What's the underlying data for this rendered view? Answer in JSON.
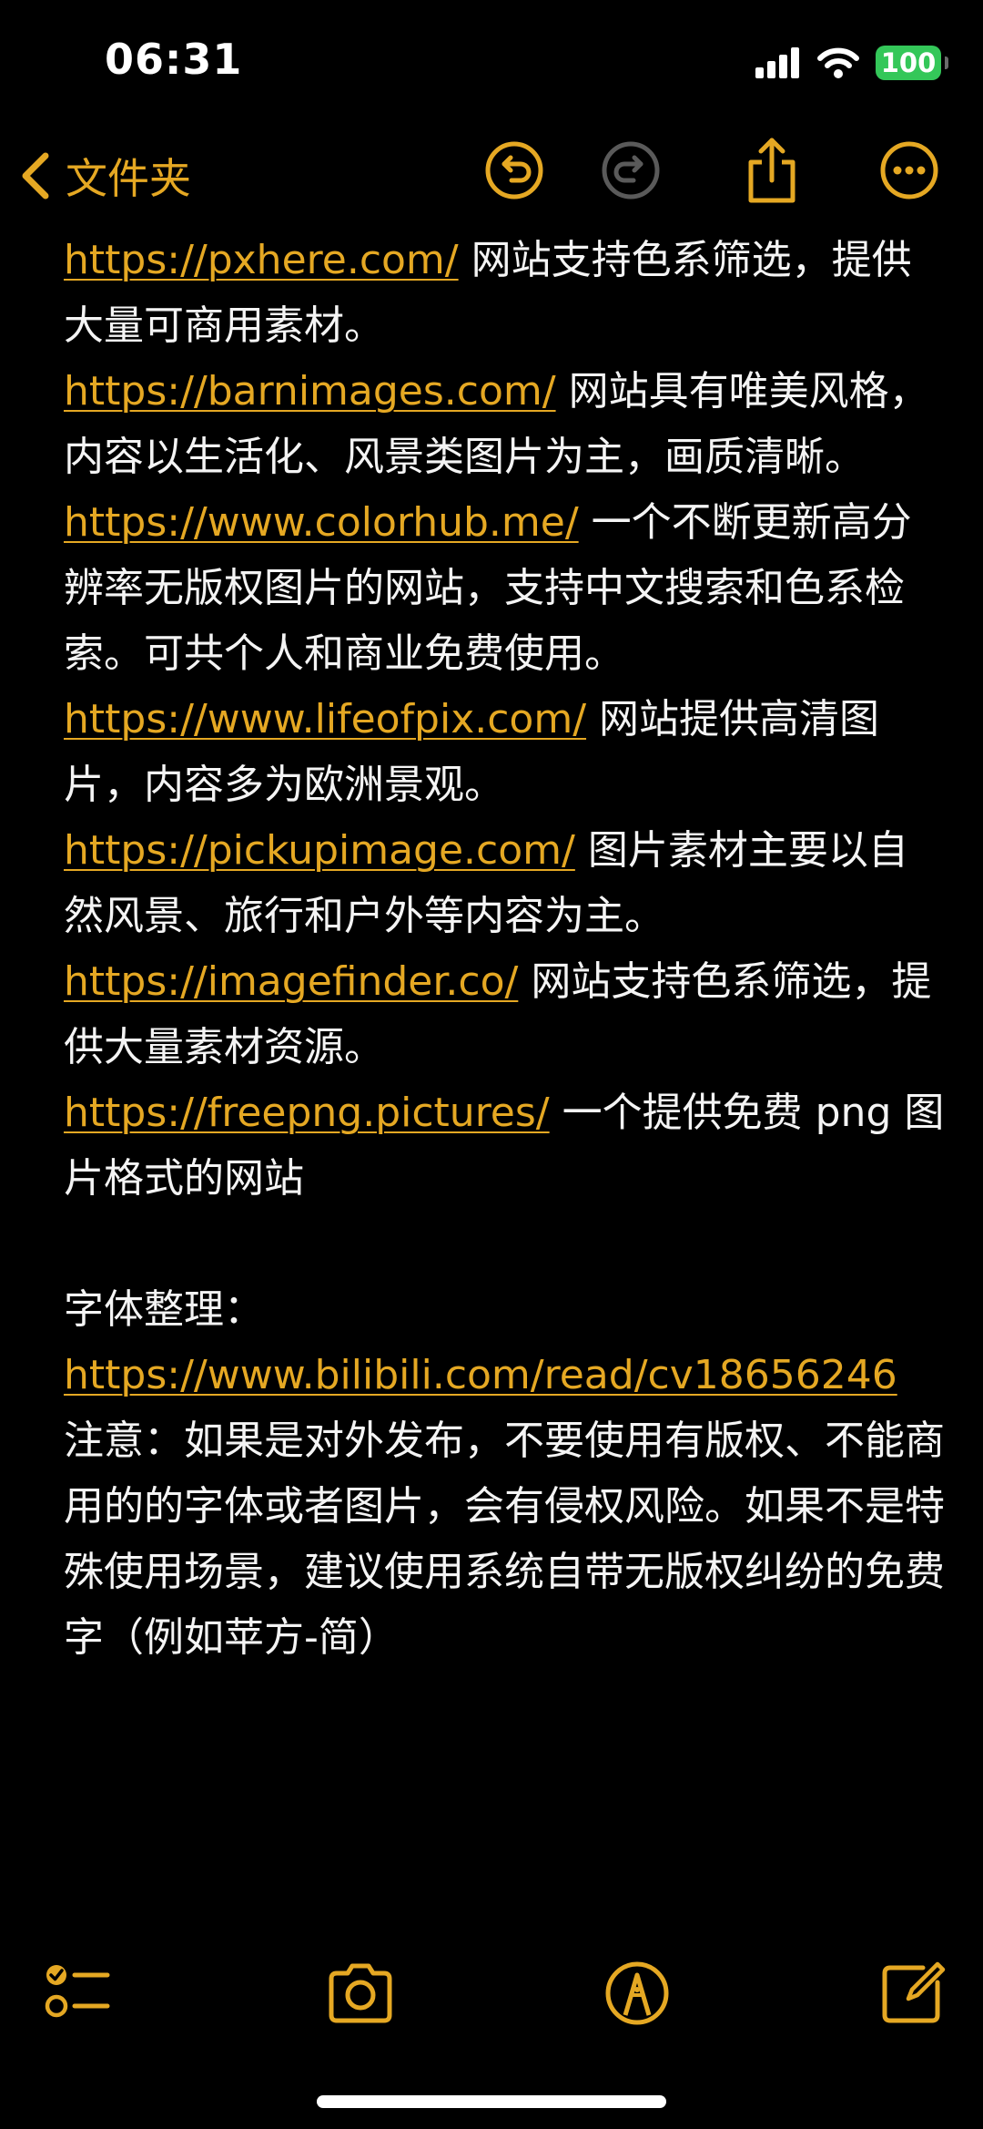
{
  "status_bar": {
    "time": "06:31",
    "battery": "100",
    "battery_color": "#34c759"
  },
  "nav": {
    "back_label": "文件夹",
    "icons": [
      "chevron-left-icon",
      "undo-icon",
      "redo-icon",
      "share-icon",
      "more-icon"
    ],
    "accent_color": "#e5a823"
  },
  "entries": [
    {
      "url": "https://pxhere.com/",
      "desc": "网站支持色系筛选，提供大量可商用素材。"
    },
    {
      "url": "https://barnimages.com/",
      "desc": "网站具有唯美风格，内容以生活化、风景类图片为主，画质清晰。"
    },
    {
      "url": "https://www.colorhub.me/",
      "desc": "一个不断更新高分辨率无版权图片的网站，支持中文搜索和色系检索。可共个人和商业免费使用。"
    },
    {
      "url": "https://www.lifeofpix.com/",
      "desc": "网站提供高清图片，内容多为欧洲景观。"
    },
    {
      "url": "https://pickupimage.com/",
      "desc": "图片素材主要以自然风景、旅行和户外等内容为主。"
    },
    {
      "url": "https://imagefinder.co/",
      "desc": "网站支持色系筛选，提供大量素材资源。"
    },
    {
      "url": "https://freepng.pictures/",
      "desc": "一个提供免费 png 图片格式的网站"
    }
  ],
  "fonts_section": {
    "heading": "字体整理：",
    "url": "https://www.bilibili.com/read/cv18656246",
    "notice": "注意：如果是对外发布，不要使用有版权、不能商用的的字体或者图片，会有侵权风险。如果不是特殊使用场景，建议使用系统自带无版权纠纷的免费字（例如苹方-简）"
  },
  "toolbar": {
    "icons": [
      "checklist-icon",
      "camera-icon",
      "markup-icon",
      "compose-icon"
    ]
  }
}
